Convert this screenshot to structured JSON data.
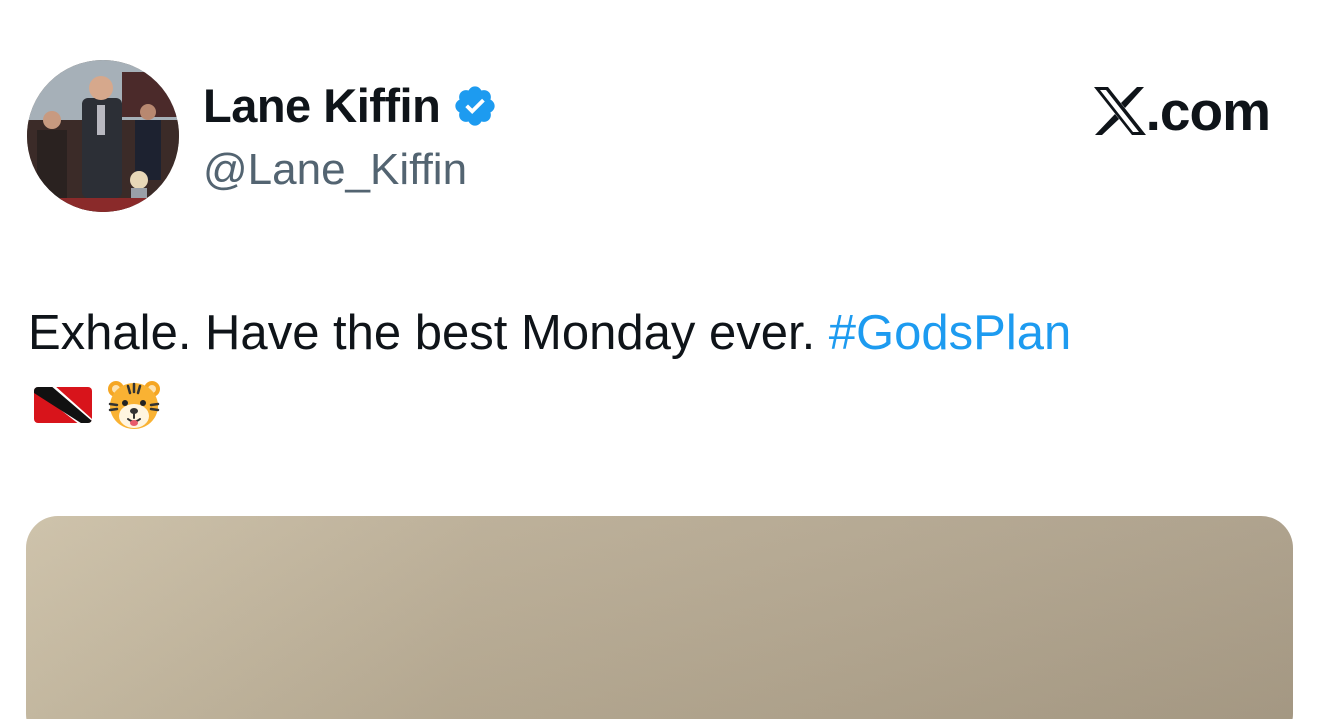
{
  "author": {
    "display_name": "Lane Kiffin",
    "handle": "@Lane_Kiffin",
    "verified": true
  },
  "brand": {
    "text": ".com",
    "icon": "x-logo-icon"
  },
  "tweet": {
    "text": "Exhale. Have the best Monday ever. ",
    "hashtag": "#GodsPlan",
    "emojis": [
      "trinidad-flag-icon",
      "tiger-face-icon"
    ]
  },
  "colors": {
    "text_primary": "#0f1419",
    "text_secondary": "#536471",
    "link": "#1d9bf0",
    "verified_badge": "#1d9bf0"
  }
}
